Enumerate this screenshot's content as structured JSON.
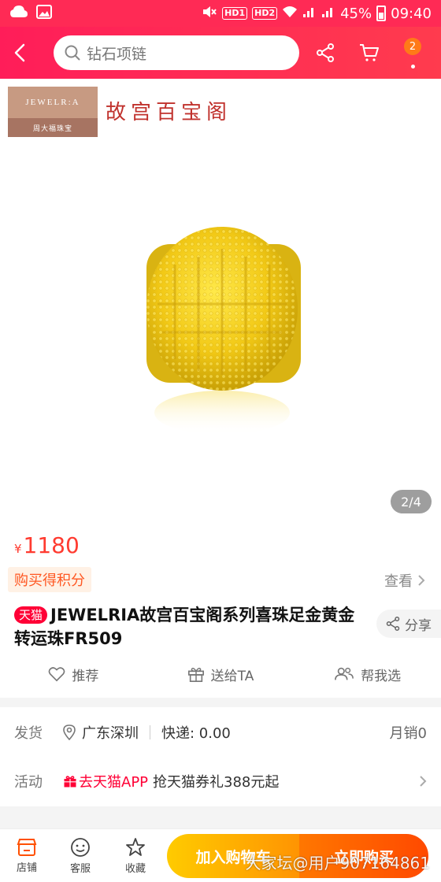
{
  "status_bar": {
    "hd1": "HD1",
    "hd2": "HD2",
    "battery": "45%",
    "time": "09:40"
  },
  "header": {
    "search_text": "钻石项链",
    "cart_count": "2"
  },
  "brand": {
    "logo_top": "JEWELR:A",
    "logo_bottom": "周大福珠宝",
    "title": "故宫百宝阁"
  },
  "product": {
    "image_index": "2/4",
    "price_symbol": "¥",
    "price": "1180",
    "points_tag": "购买得积分",
    "view_link": "查看",
    "tmall_tag": "天猫",
    "title": "JEWELRIA故宫百宝阁系列喜珠足金黄金转运珠FR509",
    "share": "分享"
  },
  "actions": {
    "recommend": "推荐",
    "gift": "送给TA",
    "help_choose": "帮我选"
  },
  "shipping": {
    "label": "发货",
    "location": "广东深圳",
    "express": "快递: 0.00",
    "monthly_sales": "月销0"
  },
  "promotion": {
    "label": "活动",
    "tag": "去天猫APP",
    "text": "抢天猫券礼388元起"
  },
  "bottom_bar": {
    "shop": "店铺",
    "service": "客服",
    "favorite": "收藏",
    "add_cart": "加入购物车",
    "buy_now": "立即购买",
    "watermark": "大家坛@用户907164861"
  },
  "colors": {
    "brand_red": "#ff2a55",
    "price_red": "#ff3b30",
    "tmall_red": "#ff0036",
    "gold": "#f2c916"
  }
}
